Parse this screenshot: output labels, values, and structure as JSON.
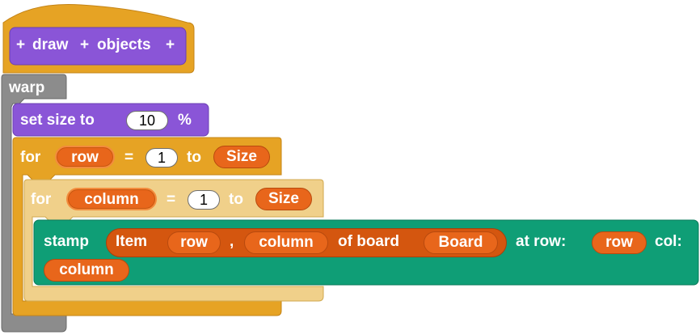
{
  "hat": {
    "parts": [
      "+",
      "draw",
      "+",
      "objects",
      "+"
    ]
  },
  "warp": {
    "label": "warp"
  },
  "set_size": {
    "label": "set size to",
    "value": "10",
    "unit": "%"
  },
  "for_row": {
    "keyword": "for",
    "var": "row",
    "eq": "=",
    "start": "1",
    "to": "to",
    "end": "Size"
  },
  "for_column": {
    "keyword": "for",
    "var": "column",
    "eq": "=",
    "start": "1",
    "to": "to",
    "end": "Size"
  },
  "stamp": {
    "label": "stamp",
    "item_label": "Item",
    "item_row": "row",
    "comma": ",",
    "item_col": "column",
    "of_board": "of board",
    "board": "Board",
    "at_row": "at row:",
    "row_var": "row",
    "col_label": "col:",
    "col_var": "column"
  },
  "colors": {
    "control": "#e6a324",
    "control_light": "#f0d08a",
    "looks": "#8a55d7",
    "other": "#8c8c8c",
    "pen": "#0f9e76",
    "variable": "#e8661b"
  }
}
